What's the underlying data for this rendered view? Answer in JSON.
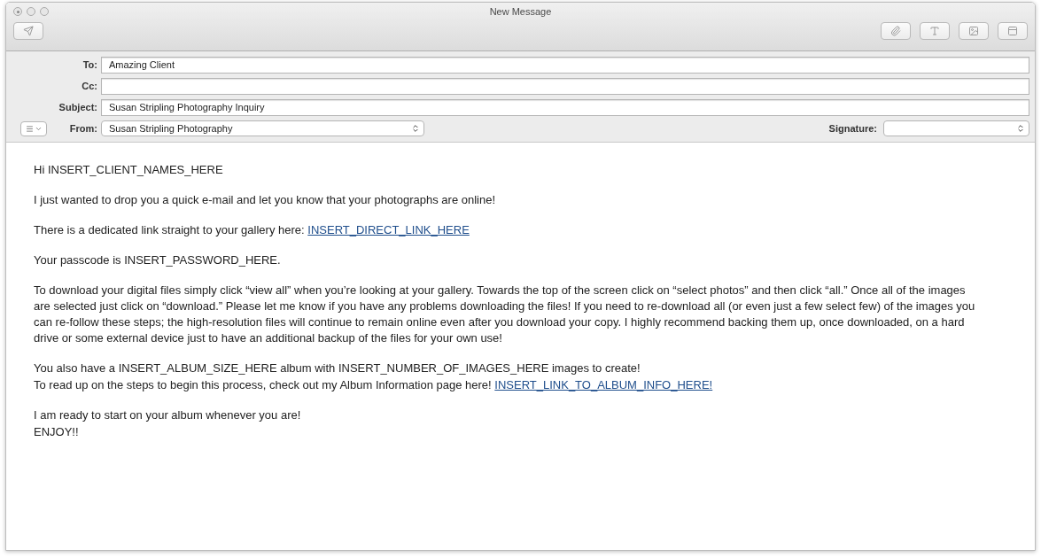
{
  "window": {
    "title": "New Message"
  },
  "header_fields": [
    {
      "label": "To:",
      "value": "Amazing Client"
    },
    {
      "label": "Cc:"
    },
    {
      "label": "Subject:",
      "value": "Susan Stripling Photography Inquiry"
    }
  ],
  "from": {
    "label": "From:",
    "value": "Susan Stripling Photography"
  },
  "signature": {
    "label": "Signature:"
  },
  "body": [
    {
      "lines": [
        {
          "text": "Hi INSERT_CLIENT_NAMES_HERE"
        }
      ]
    },
    {
      "lines": [
        {
          "text": "I just wanted to drop you a quick e-mail and let you know that your photographs are online!"
        }
      ]
    },
    {
      "lines": [
        {
          "text": "There is a dedicated link straight to your gallery here:",
          "link": "INSERT_DIRECT_LINK_HERE"
        }
      ]
    },
    {
      "lines": [
        {
          "text": "Your passcode is INSERT_PASSWORD_HERE."
        }
      ]
    },
    {
      "lines": [
        {
          "text": "To download your digital files simply click “view all” when you’re looking at your gallery. Towards the top of the screen click on “select photos” and then click “all.” Once all of the images are selected just click on “download.” Please let me know if you have any problems downloading the files! If you need to re-download all (or even just a few select few) of the images you can re-follow these steps; the high-resolution files will continue to remain online even after you download your copy. I highly recommend backing them up, once downloaded, on a hard drive or some external device just to have an additional backup of the files for your own use!"
        }
      ]
    },
    {
      "lines": [
        {
          "text": "You also have a INSERT_ALBUM_SIZE_HERE album with INSERT_NUMBER_OF_IMAGES_HERE images to create!"
        },
        {
          "text": "To read up on the steps to begin this process, check out my Album Information page here!",
          "link": "INSERT_LINK_TO_ALBUM_INFO_HERE!"
        }
      ]
    },
    {
      "lines": [
        {
          "text": "I am ready to start on your album whenever you are!"
        },
        {
          "text": "ENJOY!!"
        }
      ]
    }
  ]
}
